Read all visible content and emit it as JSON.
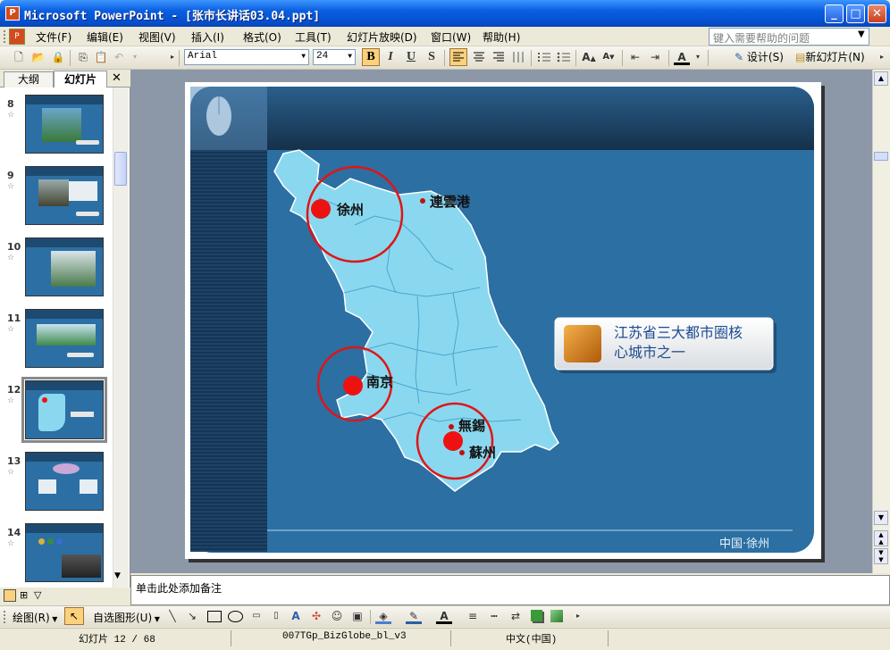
{
  "window": {
    "app_icon": "P",
    "title": "Microsoft PowerPoint - [张市长讲话03.04.ppt]",
    "minimize_glyph": "_",
    "maximize_glyph": "□",
    "close_glyph": "✕"
  },
  "menu": {
    "items": [
      "文件(F)",
      "编辑(E)",
      "视图(V)",
      "插入(I)",
      "格式(O)",
      "工具(T)",
      "幻灯片放映(D)",
      "窗口(W)",
      "帮助(H)"
    ],
    "help_placeholder": "键入需要帮助的问题"
  },
  "toolbar": {
    "font_name": "Arial",
    "font_size": "24",
    "bold": "B",
    "italic": "I",
    "underline": "U",
    "shadow": "S",
    "design_label": "设计(S)",
    "new_slide_label": "新幻灯片(N)"
  },
  "left_panel": {
    "tab_outline": "大纲",
    "tab_slides": "幻灯片",
    "close": "✕",
    "slides": [
      {
        "num": "8"
      },
      {
        "num": "9"
      },
      {
        "num": "10"
      },
      {
        "num": "11"
      },
      {
        "num": "12",
        "selected": true
      },
      {
        "num": "13"
      },
      {
        "num": "14"
      }
    ]
  },
  "slide": {
    "cities": {
      "xuzhou": "徐州",
      "lianyungang": "連雲港",
      "nanjing": "南京",
      "wuxi": "無錫",
      "suzhou": "蘇州"
    },
    "callout_line1": "江苏省三大都市圈核",
    "callout_line2": "心城市之一",
    "footer": "中国·徐州",
    "colors": {
      "background": "#2b6fa3",
      "map": "#8ad8ef",
      "marker": "#ee1111"
    }
  },
  "notes": {
    "placeholder": "单击此处添加备注"
  },
  "drawing_toolbar": {
    "draw_label": "绘图(R)",
    "autoshapes_label": "自选图形(U)"
  },
  "status": {
    "slide_position": "幻灯片 12 / 68",
    "template": "007TGp_BizGlobe_bl_v3",
    "language": "中文(中国)"
  }
}
